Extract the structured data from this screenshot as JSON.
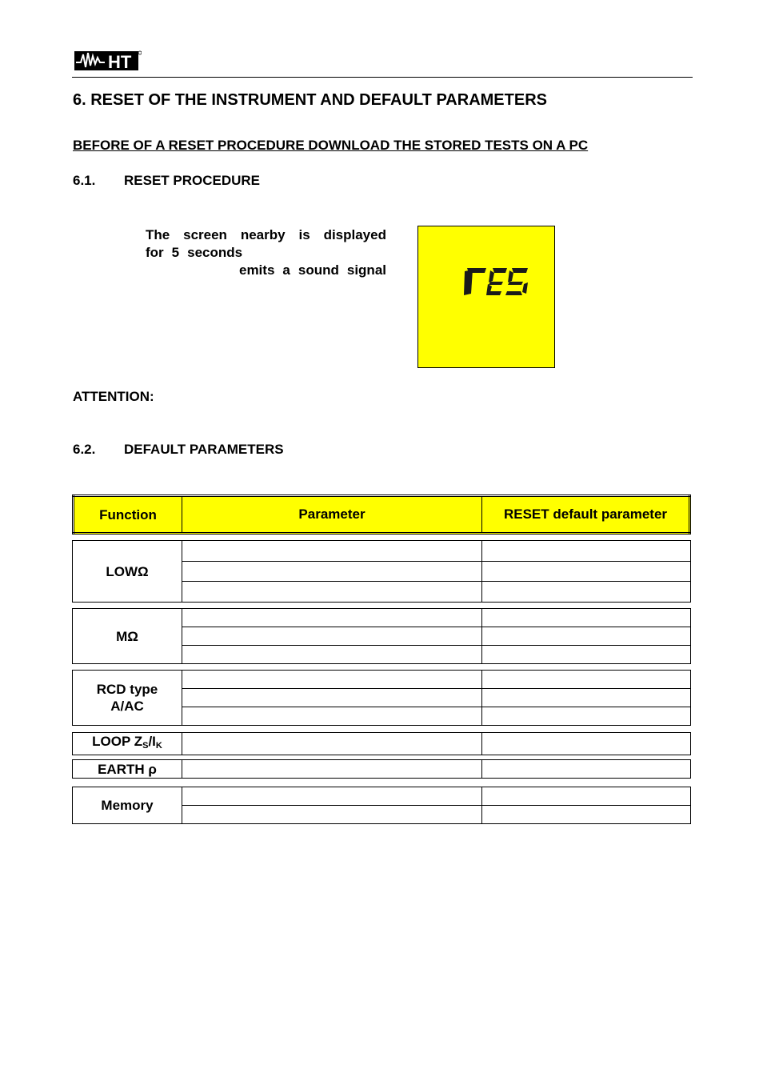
{
  "header": {
    "logo_text": "HT",
    "logo_icon": "ht-waveform-logo-icon"
  },
  "section": {
    "title": "6. RESET OF THE INSTRUMENT AND DEFAULT PARAMETERS",
    "warning": "BEFORE OF A RESET PROCEDURE DOWNLOAD THE STORED TESTS ON A PC"
  },
  "subsection1": {
    "number": "6.1.",
    "title": "RESET PROCEDURE",
    "paragraph_lines": [
      [
        "The",
        "screen",
        "nearby",
        "is",
        "displayed"
      ],
      [
        "for",
        "5",
        "seconds"
      ],
      [
        "emits",
        "a",
        "sound",
        "signal"
      ]
    ],
    "lcd_text": "rES",
    "lcd_color": "#ffff00",
    "attention_label": "ATTENTION:"
  },
  "subsection2": {
    "number": "6.2.",
    "title": "DEFAULT PARAMETERS"
  },
  "table": {
    "header_color": "#ffff00",
    "columns": [
      "Function",
      "Parameter",
      "RESET default parameter"
    ],
    "groups": [
      {
        "function": "LOWΩ",
        "rows": 3
      },
      {
        "function": "MΩ",
        "rows": 3
      },
      {
        "function": "RCD type A/AC",
        "rows": 3
      },
      {
        "function_main": "LOOP Z",
        "function_sub1": "S",
        "function_mid": "/I",
        "function_sub2": "K",
        "rows": 1
      },
      {
        "function": "EARTH ρ",
        "rows": 1
      },
      {
        "function": "Memory",
        "rows": 2
      }
    ]
  }
}
